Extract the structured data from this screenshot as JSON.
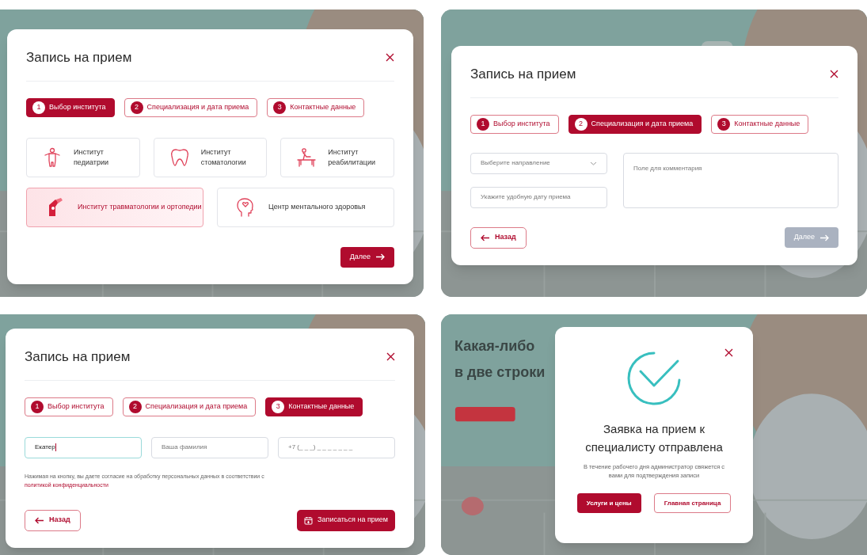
{
  "panels": [
    {
      "kind": "institutes",
      "title": "Запись на прием",
      "steps": [
        {
          "number": "1",
          "label": "Выбор института",
          "selected": true
        },
        {
          "number": "2",
          "label": "Специализация и дата приема",
          "selected": false
        },
        {
          "number": "3",
          "label": "Контактные данные",
          "selected": false
        }
      ],
      "cards": [
        {
          "label": "Институт педиатрии",
          "selected": false
        },
        {
          "label": "Институт стоматологии",
          "selected": false
        },
        {
          "label": "Институт реабилитации",
          "selected": false
        },
        {
          "label": "Институт травматологии и ортопедии",
          "selected": true
        },
        {
          "label": "Центр ментального здоровья",
          "selected": false
        }
      ],
      "next": {
        "label": "Далее",
        "disabled": false
      }
    },
    {
      "kind": "specialization",
      "title": "Запись на прием",
      "steps": [
        {
          "number": "1",
          "label": "Выбор института",
          "selected": false
        },
        {
          "number": "2",
          "label": "Специализация и дата приема",
          "selected": true
        },
        {
          "number": "3",
          "label": "Контактные данные",
          "selected": false
        }
      ],
      "direction": {
        "placeholder": "Выберите направление"
      },
      "date": {
        "placeholder": "Укажите удобную дату приема"
      },
      "comment": {
        "placeholder": "Поле для комментария"
      },
      "back": {
        "label": "Назад"
      },
      "next": {
        "label": "Далее",
        "disabled": true
      }
    },
    {
      "kind": "contacts",
      "title": "Запись на прием",
      "steps": [
        {
          "number": "1",
          "label": "Выбор института",
          "selected": false
        },
        {
          "number": "2",
          "label": "Специализация и дата приема",
          "selected": false
        },
        {
          "number": "3",
          "label": "Контактные данные",
          "selected": true
        }
      ],
      "fields": [
        {
          "value": "Екатер",
          "focused": true
        },
        {
          "placeholder": "Ваша фамилия",
          "focused": false
        },
        {
          "placeholder": "+7 (_ _ _) _ _ _  _ _  _ _",
          "focused": false
        }
      ],
      "consent": {
        "text": "Нажимая на кнопку, вы даете согласие на обработку персональных данных в соответствии с",
        "link": "политикой конфиденциальности"
      },
      "back": {
        "label": "Назад"
      },
      "submit": {
        "label": "Записаться на прием"
      }
    },
    {
      "kind": "success",
      "hero": [
        "Какая-либо",
        "в две строки"
      ],
      "title": "Заявка на прием к специалисту отправлена",
      "message": "В течение рабочего дня администратор свяжется с вами для подтверждения записи",
      "buttons": [
        {
          "label": "Услуги и цены",
          "kind": "primary"
        },
        {
          "label": "Главная страница",
          "kind": "outline"
        }
      ]
    }
  ]
}
